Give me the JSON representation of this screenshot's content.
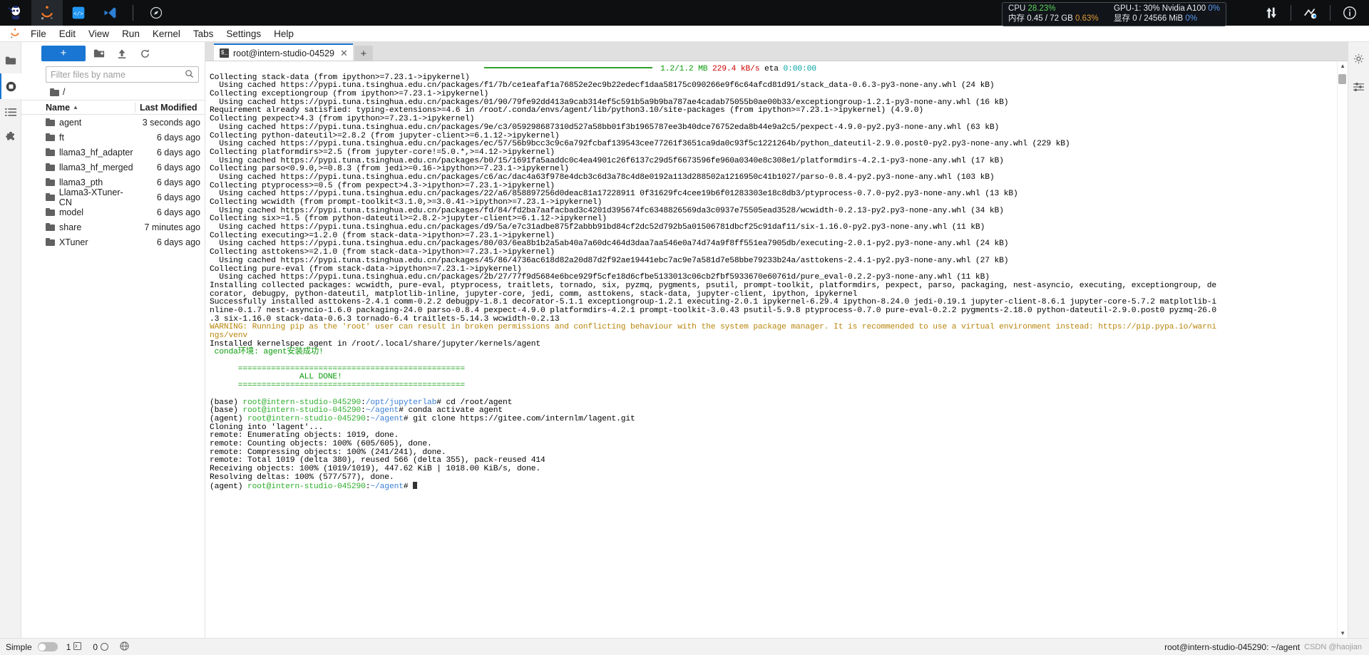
{
  "window": {
    "title": "JupyterLab — root@intern-studio-045290"
  },
  "topbar": {
    "icons": [
      {
        "name": "intern-studio-logo",
        "glyph": "◉"
      },
      {
        "name": "jupyter-logo",
        "glyph": "◡"
      },
      {
        "name": "code-brackets-icon",
        "glyph": "‹/›"
      },
      {
        "name": "vscode-icon",
        "glyph": "✕"
      },
      {
        "name": "compass-icon",
        "glyph": "◍"
      }
    ],
    "sysmon": {
      "cpu_label": "CPU",
      "cpu_value": "28.23%",
      "gpu_label": "GPU-1: 30% Nvidia A100",
      "gpu_value": "0%",
      "mem_label": "内存",
      "mem_value": "0.45 / 72 GB",
      "mem_pct": "0.63%",
      "vram_label": "显存",
      "vram_value": "0 / 24566 MiB",
      "vram_pct": "0%"
    },
    "right_icons": [
      {
        "name": "upload-download-icon",
        "glyph": "⇅"
      },
      {
        "name": "ssh-connection-icon",
        "glyph": "⇲"
      },
      {
        "name": "info-icon",
        "glyph": "ⓘ"
      }
    ]
  },
  "menubar": {
    "items": [
      {
        "label": "File"
      },
      {
        "label": "Edit"
      },
      {
        "label": "View"
      },
      {
        "label": "Run"
      },
      {
        "label": "Kernel"
      },
      {
        "label": "Tabs"
      },
      {
        "label": "Settings"
      },
      {
        "label": "Help"
      }
    ]
  },
  "left_rail": {
    "items": [
      {
        "name": "file-browser-icon",
        "glyph": "folder"
      },
      {
        "name": "running-terminals-icon",
        "glyph": "stop"
      },
      {
        "name": "table-of-contents-icon",
        "glyph": "list"
      },
      {
        "name": "extension-manager-icon",
        "glyph": "puzzle"
      }
    ]
  },
  "filebrowser": {
    "new_launcher_label": "+",
    "toolbar_icons": [
      {
        "name": "new-folder-icon",
        "glyph": "folder-plus"
      },
      {
        "name": "upload-icon",
        "glyph": "upload"
      },
      {
        "name": "refresh-icon",
        "glyph": "refresh"
      }
    ],
    "filter_placeholder": "Filter files by name",
    "filter_value": "",
    "breadcrumb": "/",
    "columns": {
      "name": "Name",
      "last_modified": "Last Modified"
    },
    "rows": [
      {
        "name": "agent",
        "modified": "3 seconds ago"
      },
      {
        "name": "ft",
        "modified": "6 days ago"
      },
      {
        "name": "llama3_hf_adapter",
        "modified": "6 days ago"
      },
      {
        "name": "llama3_hf_merged",
        "modified": "6 days ago"
      },
      {
        "name": "llama3_pth",
        "modified": "6 days ago"
      },
      {
        "name": "Llama3-XTuner-CN",
        "modified": "6 days ago"
      },
      {
        "name": "model",
        "modified": "6 days ago"
      },
      {
        "name": "share",
        "modified": "7 minutes ago"
      },
      {
        "name": "XTuner",
        "modified": "6 days ago"
      }
    ]
  },
  "tabbar": {
    "tabs": [
      {
        "label": "root@intern-studio-04529",
        "icon": "terminal-icon",
        "close": "✕"
      }
    ],
    "add_label": "+"
  },
  "terminal": {
    "lines": [
      [
        {
          "t": "                                                          ",
          "c": "default"
        },
        {
          "t": "__PBAR__",
          "c": "bar"
        },
        {
          "t": " 1.2/1.2 MB",
          "c": "green"
        },
        {
          "t": " 229.4 kB/s",
          "c": "red"
        },
        {
          "t": " eta ",
          "c": "default"
        },
        {
          "t": "0:00:00",
          "c": "cyan"
        }
      ],
      [
        {
          "t": "Collecting stack-data (from ipython>=7.23.1->ipykernel)",
          "c": "default"
        }
      ],
      [
        {
          "t": "  Using cached https://pypi.tuna.tsinghua.edu.cn/packages/f1/7b/ce1eafaf1a76852e2ec9b22edecf1daa58175c090266e9f6c64afcd81d91/stack_data-0.6.3-py3-none-any.whl (24 kB)",
          "c": "default"
        }
      ],
      [
        {
          "t": "Collecting exceptiongroup (from ipython>=7.23.1->ipykernel)",
          "c": "default"
        }
      ],
      [
        {
          "t": "  Using cached https://pypi.tuna.tsinghua.edu.cn/packages/01/90/79fe92dd413a9cab314ef5c591b5a9b9ba787ae4cadab75055b0ae00b33/exceptiongroup-1.2.1-py3-none-any.whl (16 kB)",
          "c": "default"
        }
      ],
      [
        {
          "t": "Requirement already satisfied: typing-extensions>=4.6 in /root/.conda/envs/agent/lib/python3.10/site-packages (from ipython>=7.23.1->ipykernel) (4.9.0)",
          "c": "default"
        }
      ],
      [
        {
          "t": "Collecting pexpect>4.3 (from ipython>=7.23.1->ipykernel)",
          "c": "default"
        }
      ],
      [
        {
          "t": "  Using cached https://pypi.tuna.tsinghua.edu.cn/packages/9e/c3/059298687310d527a58bb01f3b1965787ee3b40dce76752eda8b44e9a2c5/pexpect-4.9.0-py2.py3-none-any.whl (63 kB)",
          "c": "default"
        }
      ],
      [
        {
          "t": "Collecting python-dateutil>=2.8.2 (from jupyter-client>=6.1.12->ipykernel)",
          "c": "default"
        }
      ],
      [
        {
          "t": "  Using cached https://pypi.tuna.tsinghua.edu.cn/packages/ec/57/56b9bcc3c9c6a792fcbaf139543cee77261f3651ca9da0c93f5c1221264b/python_dateutil-2.9.0.post0-py2.py3-none-any.whl (229 kB)",
          "c": "default"
        }
      ],
      [
        {
          "t": "Collecting platformdirs>=2.5 (from jupyter-core!=5.0.*,>=4.12->ipykernel)",
          "c": "default"
        }
      ],
      [
        {
          "t": "  Using cached https://pypi.tuna.tsinghua.edu.cn/packages/b0/15/1691fa5aaddc0c4ea4901c26f6137c29d5f6673596fe960a0340e8c308e1/platformdirs-4.2.1-py3-none-any.whl (17 kB)",
          "c": "default"
        }
      ],
      [
        {
          "t": "Collecting parso<0.9.0,>=0.8.3 (from jedi>=0.16->ipython>=7.23.1->ipykernel)",
          "c": "default"
        }
      ],
      [
        {
          "t": "  Using cached https://pypi.tuna.tsinghua.edu.cn/packages/c6/ac/dac4a63f978e4dcb3c6d3a78c4d8e0192a113d288502a1216950c41b1027/parso-0.8.4-py2.py3-none-any.whl (103 kB)",
          "c": "default"
        }
      ],
      [
        {
          "t": "Collecting ptyprocess>=0.5 (from pexpect>4.3->ipython>=7.23.1->ipykernel)",
          "c": "default"
        }
      ],
      [
        {
          "t": "  Using cached https://pypi.tuna.tsinghua.edu.cn/packages/22/a6/858897256d0deac81a17228911 0f31629fc4cee19b6f01283303e18c8db3/ptyprocess-0.7.0-py2.py3-none-any.whl (13 kB)",
          "c": "default"
        }
      ],
      [
        {
          "t": "Collecting wcwidth (from prompt-toolkit<3.1.0,>=3.0.41->ipython>=7.23.1->ipykernel)",
          "c": "default"
        }
      ],
      [
        {
          "t": "  Using cached https://pypi.tuna.tsinghua.edu.cn/packages/fd/84/fd2ba7aafacbad3c4201d395674fc6348826569da3c0937e75505ead3528/wcwidth-0.2.13-py2.py3-none-any.whl (34 kB)",
          "c": "default"
        }
      ],
      [
        {
          "t": "Collecting six>=1.5 (from python-dateutil>=2.8.2->jupyter-client>=6.1.12->ipykernel)",
          "c": "default"
        }
      ],
      [
        {
          "t": "  Using cached https://pypi.tuna.tsinghua.edu.cn/packages/d9/5a/e7c31adbe875f2abbb91bd84cf2dc52d792b5a01506781dbcf25c91daf11/six-1.16.0-py2.py3-none-any.whl (11 kB)",
          "c": "default"
        }
      ],
      [
        {
          "t": "Collecting executing>=1.2.0 (from stack-data->ipython>=7.23.1->ipykernel)",
          "c": "default"
        }
      ],
      [
        {
          "t": "  Using cached https://pypi.tuna.tsinghua.edu.cn/packages/80/03/6ea8b1b2a5ab40a7a60dc464d3daa7aa546e0a74d74a9f8ff551ea7905db/executing-2.0.1-py2.py3-none-any.whl (24 kB)",
          "c": "default"
        }
      ],
      [
        {
          "t": "Collecting asttokens>=2.1.0 (from stack-data->ipython>=7.23.1->ipykernel)",
          "c": "default"
        }
      ],
      [
        {
          "t": "  Using cached https://pypi.tuna.tsinghua.edu.cn/packages/45/86/4736ac618d82a20d87d2f92ae19441ebc7ac9e7a581d7e58bbe79233b24a/asttokens-2.4.1-py2.py3-none-any.whl (27 kB)",
          "c": "default"
        }
      ],
      [
        {
          "t": "Collecting pure-eval (from stack-data->ipython>=7.23.1->ipykernel)",
          "c": "default"
        }
      ],
      [
        {
          "t": "  Using cached https://pypi.tuna.tsinghua.edu.cn/packages/2b/27/77f9d5684e6bce929f5cfe18d6cfbe5133013c06cb2fbf5933670e60761d/pure_eval-0.2.2-py3-none-any.whl (11 kB)",
          "c": "default"
        }
      ],
      [
        {
          "t": "Installing collected packages: wcwidth, pure-eval, ptyprocess, traitlets, tornado, six, pyzmq, pygments, psutil, prompt-toolkit, platformdirs, pexpect, parso, packaging, nest-asyncio, executing, exceptiongroup, de",
          "c": "default"
        }
      ],
      [
        {
          "t": "corator, debugpy, python-dateutil, matplotlib-inline, jupyter-core, jedi, comm, asttokens, stack-data, jupyter-client, ipython, ipykernel",
          "c": "default"
        }
      ],
      [
        {
          "t": "Successfully installed asttokens-2.4.1 comm-0.2.2 debugpy-1.8.1 decorator-5.1.1 exceptiongroup-1.2.1 executing-2.0.1 ipykernel-6.29.4 ipython-8.24.0 jedi-0.19.1 jupyter-client-8.6.1 jupyter-core-5.7.2 matplotlib-i",
          "c": "default"
        }
      ],
      [
        {
          "t": "nline-0.1.7 nest-asyncio-1.6.0 packaging-24.0 parso-0.8.4 pexpect-4.9.0 platformdirs-4.2.1 prompt-toolkit-3.0.43 psutil-5.9.8 ptyprocess-0.7.0 pure-eval-0.2.2 pygments-2.18.0 python-dateutil-2.9.0.post0 pyzmq-26.0",
          "c": "default"
        }
      ],
      [
        {
          "t": ".3 six-1.16.0 stack-data-0.6.3 tornado-6.4 traitlets-5.14.3 wcwidth-0.2.13",
          "c": "default"
        }
      ],
      [
        {
          "t": "WARNING",
          "c": "yellow"
        },
        {
          "t": ": Running pip as the 'root' user can result in broken permissions and conflicting behaviour with the system package manager. It is recommended to use a virtual environment instead: https://pip.pypa.io/warni",
          "c": "yellow"
        }
      ],
      [
        {
          "t": "ngs/venv",
          "c": "yellow"
        }
      ],
      [
        {
          "t": "Installed kernelspec agent in /root/.local/share/jupyter/kernels/agent",
          "c": "default"
        }
      ],
      [
        {
          "t": " conda环境: agent安装成功!",
          "c": "green"
        }
      ],
      [
        {
          "t": "",
          "c": "default"
        }
      ],
      [
        {
          "t": "      ================================================",
          "c": "green"
        }
      ],
      [
        {
          "t": "                   ALL DONE!",
          "c": "green"
        }
      ],
      [
        {
          "t": "      ================================================",
          "c": "green"
        }
      ],
      [
        {
          "t": "",
          "c": "default"
        }
      ],
      [
        {
          "t": "(base) ",
          "c": "default"
        },
        {
          "t": "root@intern-studio-045290",
          "c": "pgreen"
        },
        {
          "t": ":",
          "c": "default"
        },
        {
          "t": "/opt/jupyterlab",
          "c": "pblue"
        },
        {
          "t": "# cd /root/agent",
          "c": "default"
        }
      ],
      [
        {
          "t": "(base) ",
          "c": "default"
        },
        {
          "t": "root@intern-studio-045290",
          "c": "pgreen"
        },
        {
          "t": ":",
          "c": "default"
        },
        {
          "t": "~/agent",
          "c": "pblue"
        },
        {
          "t": "# conda activate agent",
          "c": "default"
        }
      ],
      [
        {
          "t": "(agent) ",
          "c": "default"
        },
        {
          "t": "root@intern-studio-045290",
          "c": "pgreen"
        },
        {
          "t": ":",
          "c": "default"
        },
        {
          "t": "~/agent",
          "c": "pblue"
        },
        {
          "t": "# git clone https://gitee.com/internlm/lagent.git",
          "c": "default"
        }
      ],
      [
        {
          "t": "Cloning into 'lagent'...",
          "c": "default"
        }
      ],
      [
        {
          "t": "remote: Enumerating objects: 1019, done.",
          "c": "default"
        }
      ],
      [
        {
          "t": "remote: Counting objects: 100% (605/605), done.",
          "c": "default"
        }
      ],
      [
        {
          "t": "remote: Compressing objects: 100% (241/241), done.",
          "c": "default"
        }
      ],
      [
        {
          "t": "remote: Total 1019 (delta 380), reused 566 (delta 355), pack-reused 414",
          "c": "default"
        }
      ],
      [
        {
          "t": "Receiving objects: 100% (1019/1019), 447.62 KiB | 1018.00 KiB/s, done.",
          "c": "default"
        }
      ],
      [
        {
          "t": "Resolving deltas: 100% (577/577), done.",
          "c": "default"
        }
      ],
      [
        {
          "t": "(agent) ",
          "c": "default"
        },
        {
          "t": "root@intern-studio-045290",
          "c": "pgreen"
        },
        {
          "t": ":",
          "c": "default"
        },
        {
          "t": "~/agent",
          "c": "pblue"
        },
        {
          "t": "# ",
          "c": "default"
        },
        {
          "t": "__CURSOR__",
          "c": "cursor"
        }
      ]
    ]
  },
  "right_rail": {
    "items": [
      {
        "name": "settings-gear-icon",
        "glyph": "gear"
      },
      {
        "name": "property-inspector-icon",
        "glyph": "sliders"
      }
    ]
  },
  "statusbar": {
    "mode_label": "Simple",
    "toggle_state": "off",
    "terminals_count": "1",
    "kernels_count": "0",
    "globe_icon": "globe-icon",
    "right_text": "root@intern-studio-045290: ~/agent",
    "watermark": "CSDN @haojian"
  }
}
